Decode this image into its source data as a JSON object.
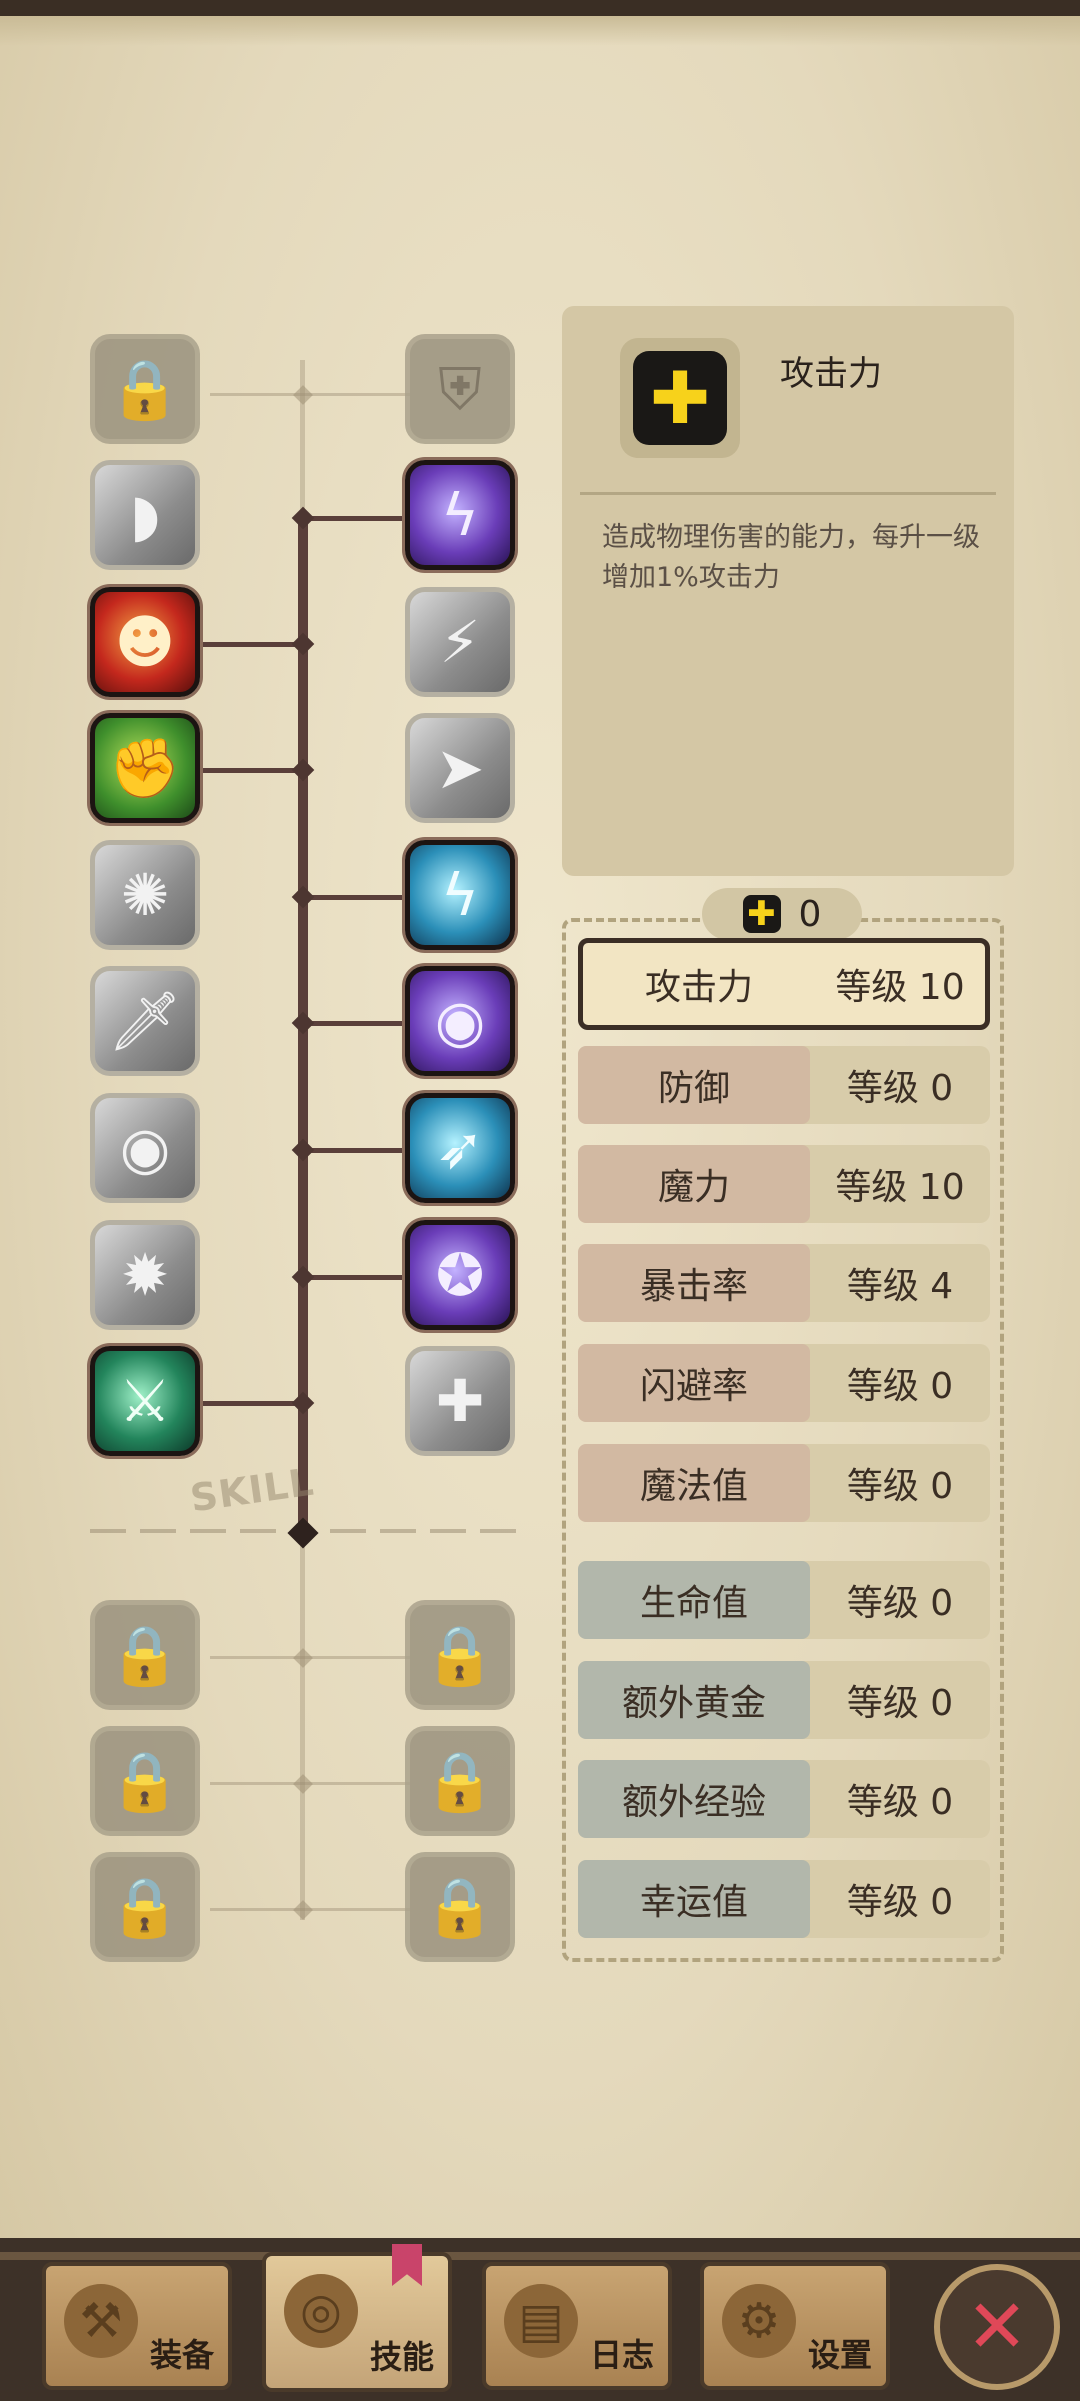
{
  "skill_tree": {
    "left_column": [
      {
        "state": "locked",
        "icon": "lock-icon"
      },
      {
        "state": "unlocked-inactive",
        "icon": "slash-icon"
      },
      {
        "state": "active",
        "icon": "rage-icon"
      },
      {
        "state": "active",
        "icon": "muscle-arm-icon"
      },
      {
        "state": "unlocked-inactive",
        "icon": "burst-icon"
      },
      {
        "state": "unlocked-inactive",
        "icon": "dagger-icon"
      },
      {
        "state": "unlocked-inactive",
        "icon": "spin-attack-icon"
      },
      {
        "state": "unlocked-inactive",
        "icon": "berserk-icon"
      },
      {
        "state": "active",
        "icon": "crossed-swords-icon"
      }
    ],
    "right_column": [
      {
        "state": "locked",
        "icon": "shield-lock-icon"
      },
      {
        "state": "active",
        "icon": "lightning-strike-icon"
      },
      {
        "state": "unlocked-inactive",
        "icon": "thunder-icon"
      },
      {
        "state": "unlocked-inactive",
        "icon": "dash-icon"
      },
      {
        "state": "active",
        "icon": "electric-shock-icon"
      },
      {
        "state": "active",
        "icon": "eye-icon"
      },
      {
        "state": "active",
        "icon": "whirlwind-blade-icon"
      },
      {
        "state": "active",
        "icon": "skull-orb-icon"
      },
      {
        "state": "unlocked-inactive",
        "icon": "heal-icon"
      }
    ],
    "section_label": "SKILL",
    "locked_left": [
      "lock-icon",
      "lock-icon",
      "lock-icon"
    ],
    "locked_right": [
      "lock-icon",
      "lock-icon",
      "lock-icon"
    ]
  },
  "info_panel": {
    "icon": "plus-icon",
    "title": "攻击力",
    "description": "造成物理伤害的能力，每升一级增加1%攻击力"
  },
  "points": {
    "icon": "plus-icon",
    "value": "0"
  },
  "stats": [
    {
      "name": "攻击力",
      "level": "等级 10",
      "group": "warm",
      "selected": true
    },
    {
      "name": "防御",
      "level": "等级 0",
      "group": "warm",
      "selected": false
    },
    {
      "name": "魔力",
      "level": "等级 10",
      "group": "warm",
      "selected": false
    },
    {
      "name": "暴击率",
      "level": "等级 4",
      "group": "warm",
      "selected": false
    },
    {
      "name": "闪避率",
      "level": "等级 0",
      "group": "warm",
      "selected": false
    },
    {
      "name": "魔法值",
      "level": "等级 0",
      "group": "warm",
      "selected": false
    },
    {
      "name": "生命值",
      "level": "等级 0",
      "group": "cool",
      "selected": false
    },
    {
      "name": "额外黄金",
      "level": "等级 0",
      "group": "cool",
      "selected": false
    },
    {
      "name": "额外经验",
      "level": "等级 0",
      "group": "cool",
      "selected": false
    },
    {
      "name": "幸运值",
      "level": "等级 0",
      "group": "cool",
      "selected": false
    }
  ],
  "nav": {
    "tabs": [
      {
        "label": "装备",
        "icon": "axe-icon",
        "active": false
      },
      {
        "label": "技能",
        "icon": "skill-ring-icon",
        "active": true
      },
      {
        "label": "日志",
        "icon": "journal-icon",
        "active": false
      },
      {
        "label": "设置",
        "icon": "gear-icon",
        "active": false
      }
    ],
    "close_icon": "close-icon"
  },
  "colors": {
    "paper": "#e6dcc0",
    "trunk": "#5a3f3a",
    "accent_yellow": "#f7d21b",
    "close_red": "#e04858"
  }
}
